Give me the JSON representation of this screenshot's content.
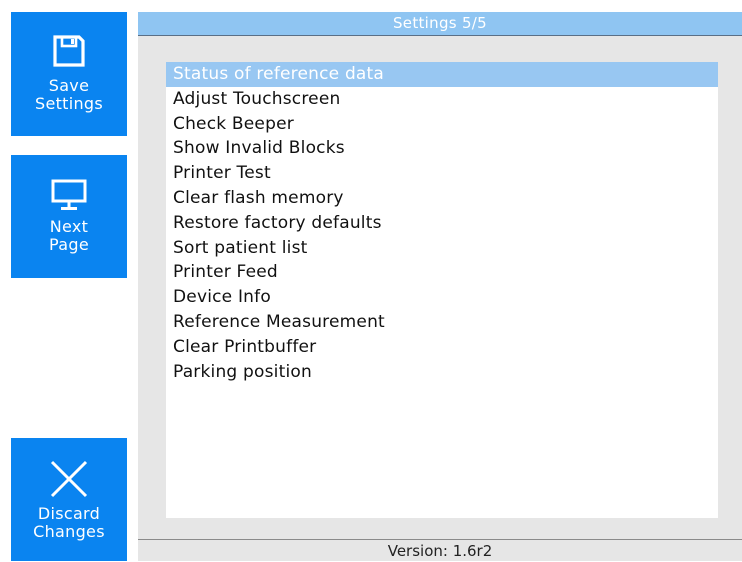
{
  "sidebar": {
    "save": {
      "label_line1": "Save",
      "label_line2": "Settings",
      "icon": "floppy-disk-icon"
    },
    "next": {
      "label_line1": "Next",
      "label_line2": "Page",
      "icon": "monitor-icon"
    },
    "discard": {
      "label_line1": "Discard",
      "label_line2": "Changes",
      "icon": "close-x-icon"
    }
  },
  "panel": {
    "title": "Settings 5/5",
    "items": [
      {
        "label": "Status of reference data",
        "selected": true
      },
      {
        "label": "Adjust Touchscreen"
      },
      {
        "label": "Check Beeper"
      },
      {
        "label": "Show Invalid Blocks"
      },
      {
        "label": "Printer Test"
      },
      {
        "label": "Clear flash memory"
      },
      {
        "label": "Restore factory defaults"
      },
      {
        "label": "Sort patient list"
      },
      {
        "label": "Printer Feed"
      },
      {
        "label": "Device Info"
      },
      {
        "label": "Reference Measurement"
      },
      {
        "label": "Clear Printbuffer"
      },
      {
        "label": "Parking position"
      }
    ],
    "version": "Version: 1.6r2"
  },
  "colors": {
    "accent": "#0a84f0",
    "selection": "#98c7f2",
    "background": "#e6e6e6"
  }
}
